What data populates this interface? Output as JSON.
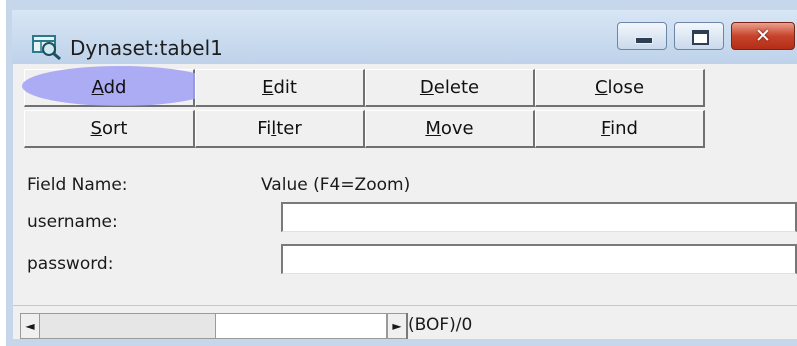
{
  "window": {
    "title": "Dynaset:tabel1",
    "app_icon": "dynaset-table-magnifier-icon",
    "controls": {
      "minimize_icon": "minimize-icon",
      "maximize_icon": "maximize-icon",
      "close_glyph": "✕"
    }
  },
  "toolbar": {
    "row1": [
      {
        "prefix": "",
        "mnemonic": "A",
        "rest": "dd"
      },
      {
        "prefix": "",
        "mnemonic": "E",
        "rest": "dit"
      },
      {
        "prefix": "",
        "mnemonic": "D",
        "rest": "elete"
      },
      {
        "prefix": "",
        "mnemonic": "C",
        "rest": "lose"
      }
    ],
    "row2": [
      {
        "prefix": "",
        "mnemonic": "S",
        "rest": "ort"
      },
      {
        "prefix": "Fi",
        "mnemonic": "l",
        "rest": "ter"
      },
      {
        "prefix": "",
        "mnemonic": "M",
        "rest": "ove"
      },
      {
        "prefix": "",
        "mnemonic": "F",
        "rest": "ind"
      }
    ],
    "highlighted": "Add"
  },
  "form": {
    "field_name_header": "Field Name:",
    "value_header": "Value (F4=Zoom)",
    "fields": [
      {
        "label": "username:",
        "value": ""
      },
      {
        "label": "password:",
        "value": ""
      }
    ]
  },
  "scrollbar": {
    "left_arrow": "◄",
    "right_arrow": "►"
  },
  "status": {
    "position_text": "(BOF)/0"
  },
  "colors": {
    "title_bar": "#c6d7ec",
    "client": "#f0f0f0",
    "highlight": "#a0a0f5",
    "close_button": "#c7432c"
  }
}
